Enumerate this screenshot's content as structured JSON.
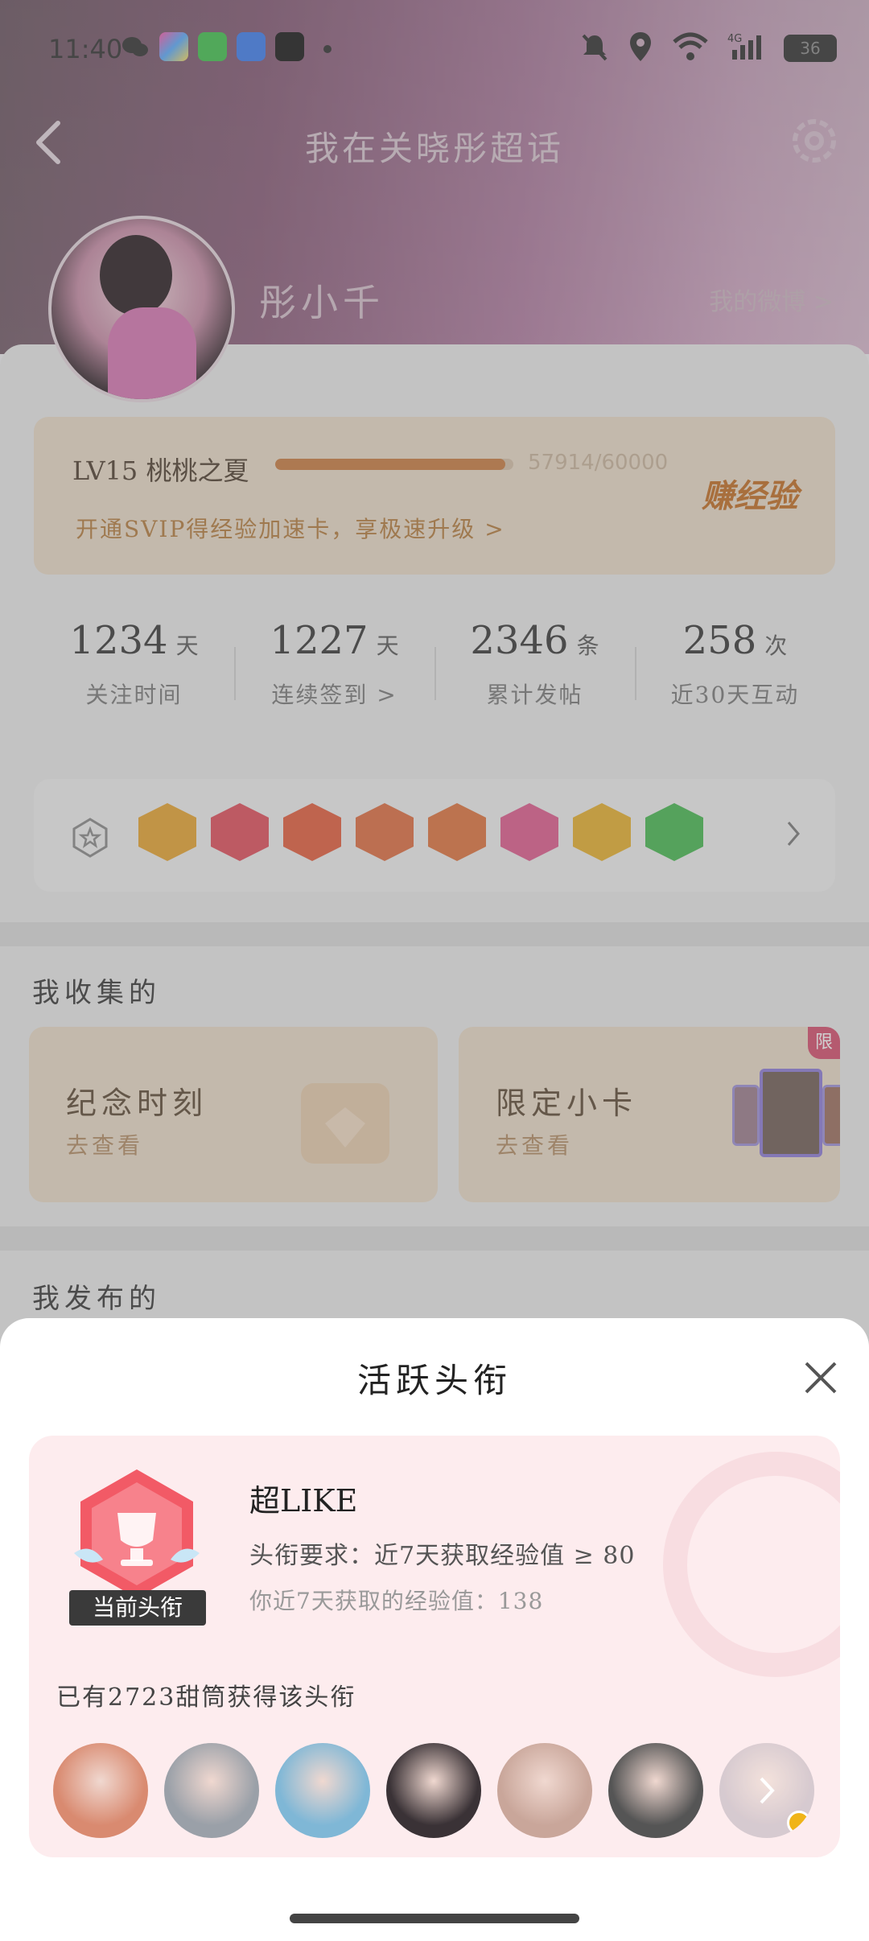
{
  "status_bar": {
    "time": "11:40",
    "battery": "36",
    "network": "4G"
  },
  "nav": {
    "title": "我在关晓彤超话"
  },
  "profile": {
    "username": "彤小千",
    "weibo_link": "我的微博 >"
  },
  "level": {
    "label": "LV15 桃桃之夏",
    "progress_text": "57914/60000",
    "progress_fraction": 0.965,
    "promo": "开通SVIP得经验加速卡，享极速升级 >",
    "earn_button": "赚经验"
  },
  "stats": [
    {
      "value": "1234",
      "unit": "天",
      "label": "关注时间"
    },
    {
      "value": "1227",
      "unit": "天",
      "label": "连续签到 >"
    },
    {
      "value": "2346",
      "unit": "条",
      "label": "累计发帖"
    },
    {
      "value": "258",
      "unit": "次",
      "label": "近30天互动"
    }
  ],
  "badges": {
    "colors": [
      "#e9a32c",
      "#e24a58",
      "#e55a38",
      "#e06a3c",
      "#e0703a",
      "#e0588c",
      "#e8b028",
      "#42b84e"
    ]
  },
  "collected": {
    "title": "我收集的",
    "cards": [
      {
        "title": "纪念时刻",
        "subtitle": "去查看"
      },
      {
        "title": "限定小卡",
        "subtitle": "去查看",
        "tag": "限"
      }
    ]
  },
  "published": {
    "title": "我发布的"
  },
  "sheet": {
    "title": "活跃头衔",
    "current_tag": "当前头衔",
    "badge_name": "超LIKE",
    "requirement": "头衔要求：近7天获取经验值 ≥ 80",
    "my_exp": "你近7天获取的经验值：138",
    "fans_text": "已有2723甜筒获得该头衔",
    "avatar_colors": [
      "#d98a70",
      "#9aa0a8",
      "#7fb7d6",
      "#3a3236",
      "#c9a69a",
      "#555",
      "#c9b8c0"
    ]
  },
  "colors": {
    "accent": "#c97a3c",
    "sheet_bg": "#fdecee"
  }
}
